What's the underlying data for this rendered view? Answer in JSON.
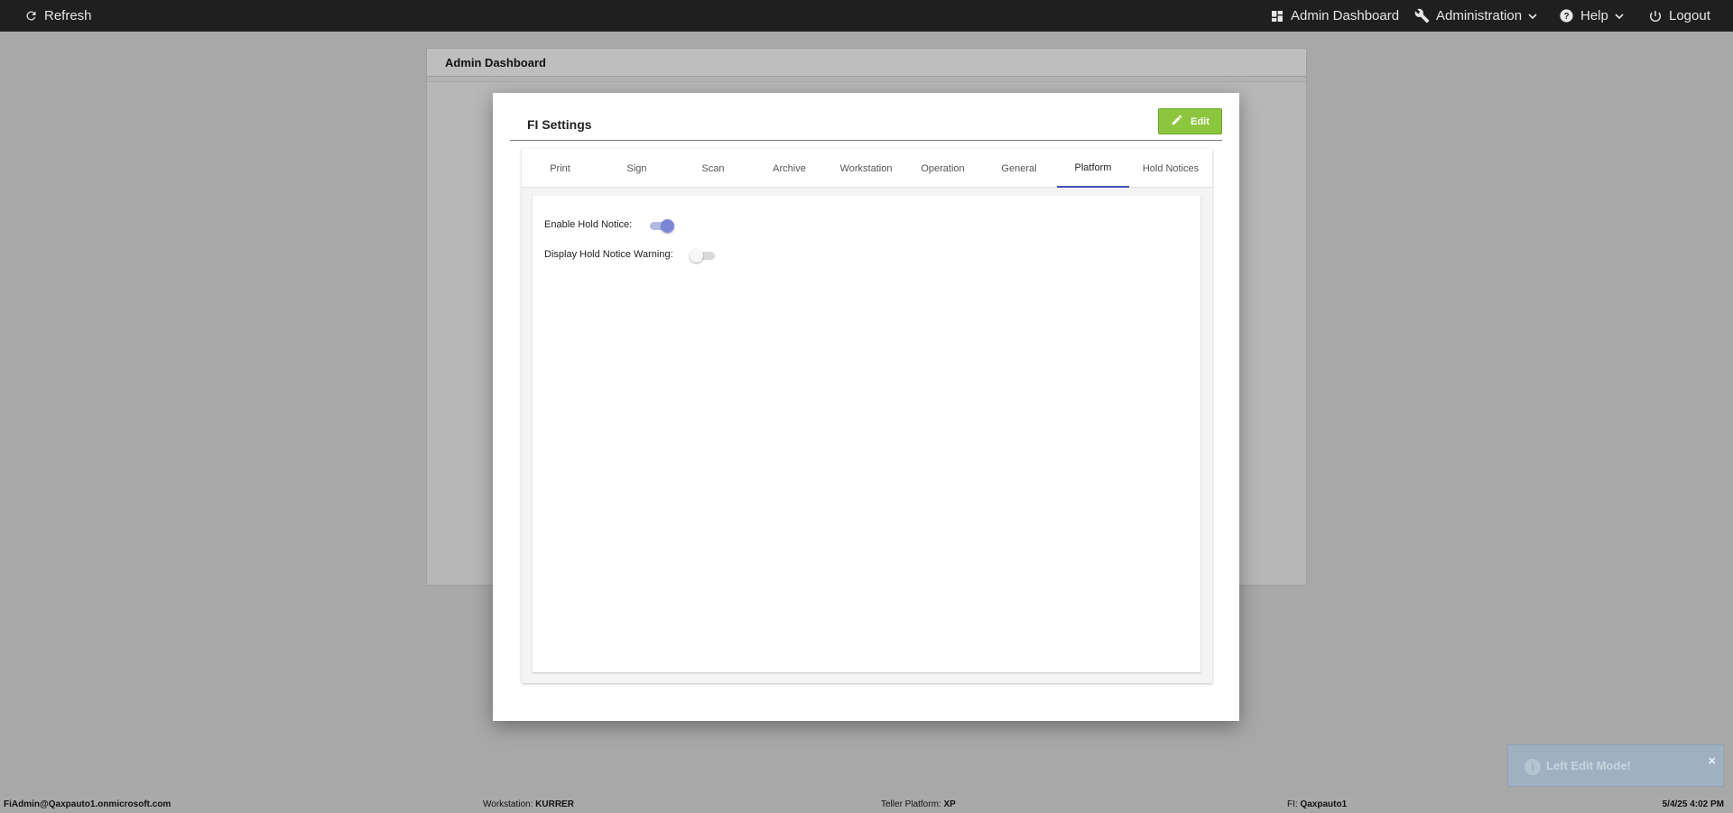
{
  "topnav": {
    "refresh_label": "Refresh",
    "admin_dashboard_label": "Admin Dashboard",
    "administration_label": "Administration",
    "help_label": "Help",
    "logout_label": "Logout"
  },
  "background_page": {
    "title": "Admin Dashboard"
  },
  "modal": {
    "title": "FI Settings",
    "edit_label": "Edit",
    "tabs": [
      {
        "label": "Print"
      },
      {
        "label": "Sign"
      },
      {
        "label": "Scan"
      },
      {
        "label": "Archive"
      },
      {
        "label": "Workstation"
      },
      {
        "label": "Operation"
      },
      {
        "label": "General"
      },
      {
        "label": "Platform",
        "active": true
      },
      {
        "label": "Hold Notices"
      }
    ],
    "fields": {
      "enable_hold_notice": {
        "label": "Enable Hold Notice:",
        "value": true
      },
      "display_hold_notice_warning": {
        "label": "Display Hold Notice Warning:",
        "value": false
      }
    }
  },
  "toast": {
    "message": "Left Edit Mode!",
    "close": "×"
  },
  "statusbar": {
    "user": "FiAdmin@Qaxpauto1.onmicrosoft.com",
    "workstation_label": "Workstation:",
    "workstation_value": "KURRER",
    "teller_platform_label": "Teller Platform:",
    "teller_platform_value": "XP",
    "fi_label": "FI:",
    "fi_value": "Qaxpauto1",
    "datetime": "5/4/25 4:02 PM"
  },
  "colors": {
    "accent": "#3f51b5",
    "edit_button": "#8cc63f",
    "toggle_on": "#7b86d6"
  }
}
